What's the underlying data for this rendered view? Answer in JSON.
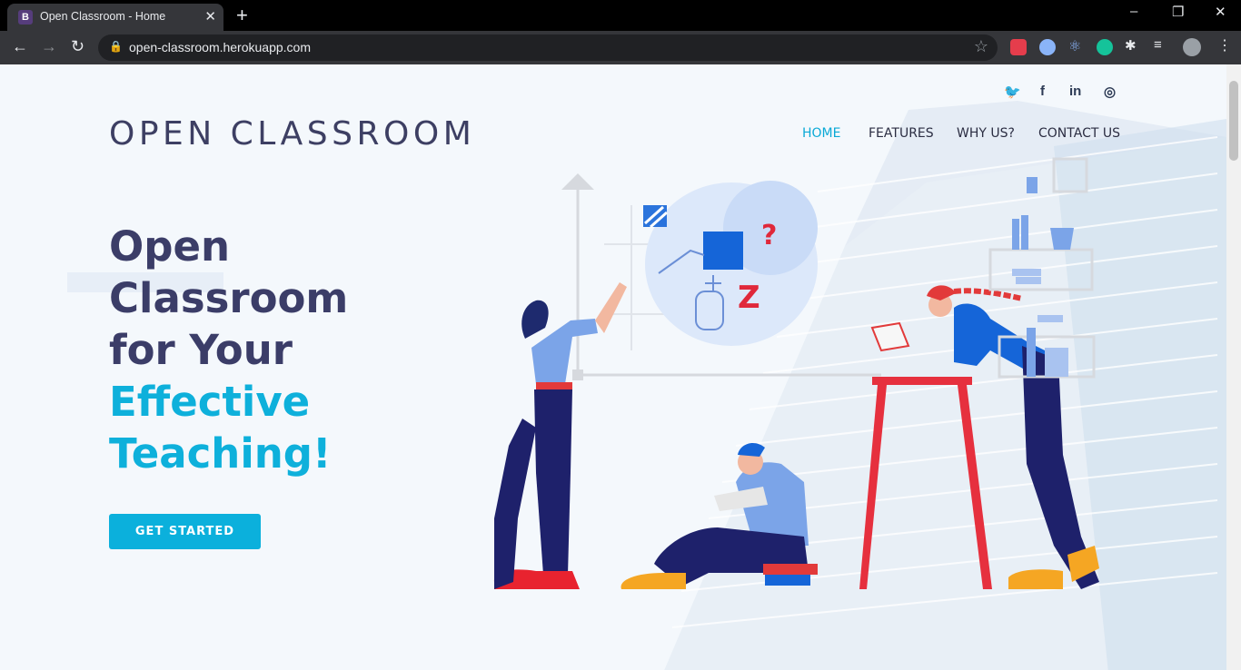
{
  "browser": {
    "tab_title": "Open Classroom - Home",
    "tab_favicon": "B",
    "new_tab": "+",
    "tab_close": "✕",
    "url": "open-classroom.herokuapp.com",
    "window_controls": {
      "minimize": "–",
      "restore": "❐",
      "close": "✕"
    }
  },
  "social": {
    "icons": [
      "twitter-icon",
      "facebook-icon",
      "linkedin-icon",
      "instagram-icon"
    ],
    "twitter": "🐦",
    "facebook": "f",
    "linkedin": "in",
    "instagram": "◎"
  },
  "header": {
    "logo": "OPEN CLASSROOM",
    "nav": [
      {
        "label": "HOME",
        "active": true
      },
      {
        "label": "FEATURES",
        "active": false
      },
      {
        "label": "WHY US?",
        "active": false
      },
      {
        "label": "CONTACT US",
        "active": false
      }
    ]
  },
  "hero": {
    "line1": "Open",
    "line2": "Classroom",
    "line3": "for Your",
    "line4": "Effective",
    "line5": "Teaching!",
    "cta_label": "GET STARTED"
  },
  "colors": {
    "accent": "#0bb0dc",
    "heading": "#3b3d68",
    "page_bg": "#f4f8fc"
  }
}
